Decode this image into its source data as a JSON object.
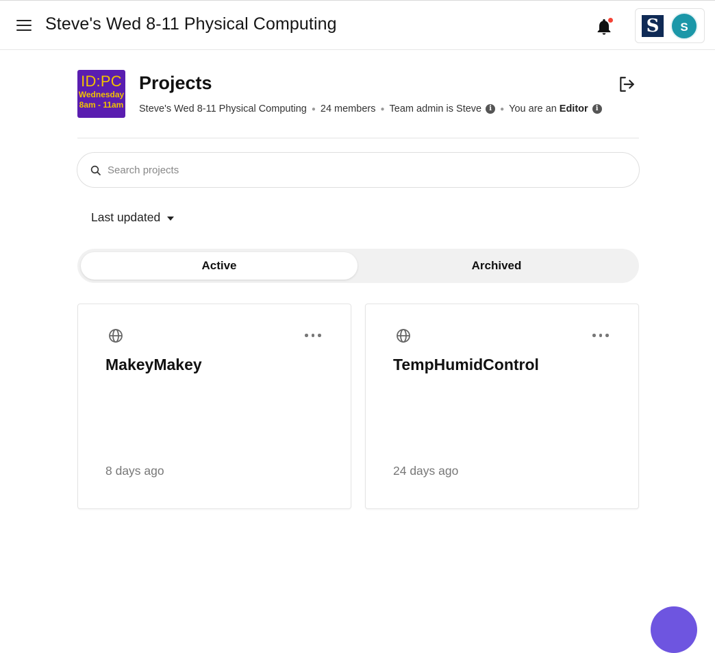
{
  "topbar": {
    "title": "Steve's Wed 8-11 Physical Computing",
    "team_badge_letter": "S",
    "user_avatar_letter": "S"
  },
  "header": {
    "logo": {
      "line1": "ID:PC",
      "line2": "Wednesday",
      "line3": "8am - 11am"
    },
    "title": "Projects",
    "team_name": "Steve's Wed 8-11 Physical Computing",
    "members": "24 members",
    "admin": "Team admin is Steve",
    "role_prefix": "You are an",
    "role": "Editor"
  },
  "search": {
    "placeholder": "Search projects",
    "value": ""
  },
  "sort": {
    "label": "Last updated"
  },
  "tabs": [
    {
      "label": "Active",
      "selected": true
    },
    {
      "label": "Archived",
      "selected": false
    }
  ],
  "projects": [
    {
      "name": "MakeyMakey",
      "updated": "8 days ago",
      "visibility_icon": "globe-icon"
    },
    {
      "name": "TempHumidControl",
      "updated": "24 days ago",
      "visibility_icon": "globe-icon"
    }
  ],
  "colors": {
    "accent": "#6e55e0",
    "notification_dot": "#f44336",
    "avatar": "#1b97a8",
    "logo_bg": "#5a1db0",
    "logo_text": "#f2c200"
  }
}
